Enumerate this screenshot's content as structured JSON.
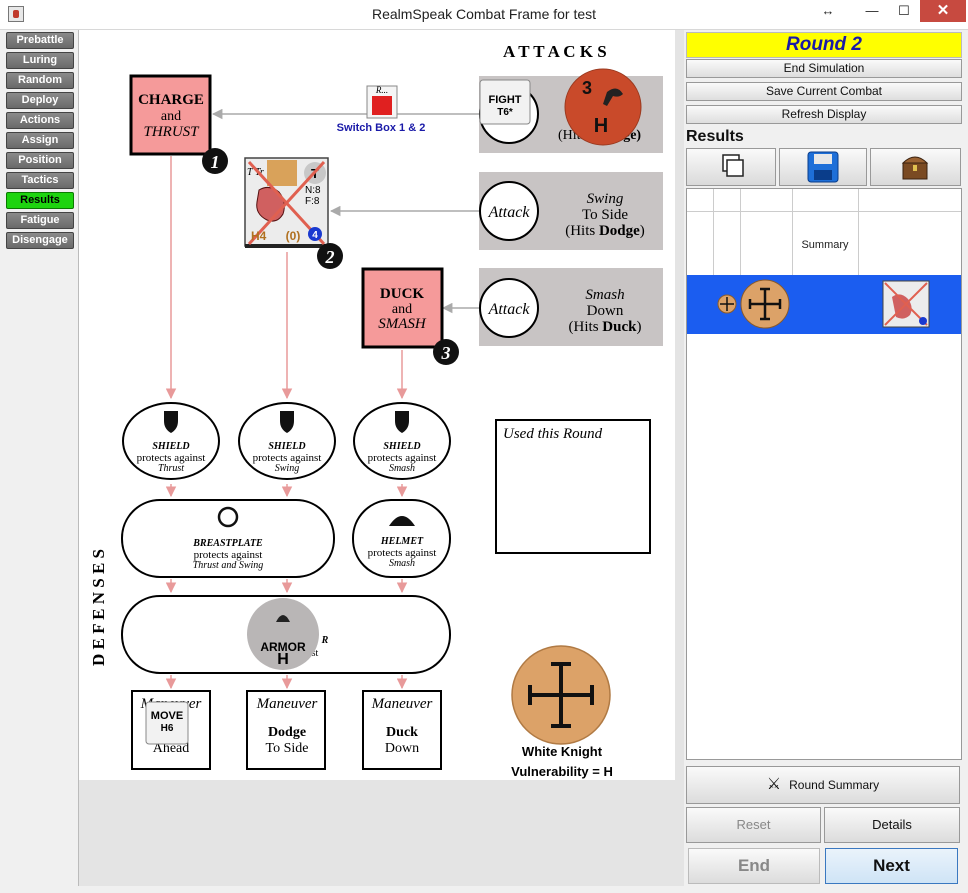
{
  "window": {
    "title": "RealmSpeak Combat Frame for test",
    "resize": "↔",
    "minimize": "—",
    "maximize": "☐",
    "close": "✕"
  },
  "nav": {
    "items": [
      {
        "label": "Prebattle"
      },
      {
        "label": "Luring"
      },
      {
        "label": "Random"
      },
      {
        "label": "Deploy"
      },
      {
        "label": "Actions"
      },
      {
        "label": "Assign"
      },
      {
        "label": "Position"
      },
      {
        "label": "Tactics"
      },
      {
        "label": "Results",
        "active": true
      },
      {
        "label": "Fatigue"
      },
      {
        "label": "Disengage"
      }
    ]
  },
  "board": {
    "attacks_title": "A T T A C K S",
    "defenses_title": "D E F E N S E S",
    "charge": {
      "line1": "CHARGE",
      "line2": "and",
      "line3": "THRUST",
      "number": "1"
    },
    "duck": {
      "line1": "DUCK",
      "line2": "and",
      "line3": "SMASH",
      "number": "3"
    },
    "switch_box": {
      "label": "R...",
      "text": "Switch Box 1 & 2"
    },
    "fight_chit": {
      "line1": "FIGHT",
      "line2": "T6*"
    },
    "monster_chit": {
      "number": "3",
      "letter": "H"
    },
    "attack_rows": [
      {
        "circle": "",
        "line1": "",
        "line2": "(Hits",
        "line3": "arge)"
      },
      {
        "circle": "Attack",
        "line1": "Swing",
        "line2": "To Side",
        "line3": "(Hits ",
        "bold": "Dodge",
        "end": ")"
      },
      {
        "circle": "Attack",
        "line1": "Smash",
        "line2": "Down",
        "line3": "(Hits ",
        "bold": "Duck",
        "end": ")"
      }
    ],
    "enemy_card": {
      "name": "T Tr",
      "type": "T",
      "stats1": "N:8",
      "stats2": "F:8",
      "bottom_left": "H4",
      "bottom_mid": "(0)",
      "badge": "4",
      "number": "2"
    },
    "used_round": "Used this Round",
    "shields": [
      {
        "title": "SHIELD",
        "line": "protects against",
        "target": "Thrust"
      },
      {
        "title": "SHIELD",
        "line": "protects against",
        "target": "Swing"
      },
      {
        "title": "SHIELD",
        "line": "protects against",
        "target": "Smash"
      }
    ],
    "breastplate": {
      "title": "BREASTPLATE",
      "line": "protects against",
      "target": "Thrust and Swing"
    },
    "helmet": {
      "title": "HELMET",
      "line": "protects against",
      "target": "Smash"
    },
    "armor_row": {
      "partial": "R",
      "partial2": "st"
    },
    "armor_chit": {
      "label": "ARMOR",
      "letter": "H"
    },
    "maneuvers": [
      {
        "title": "Maneuver",
        "line1": "",
        "line2": "Ahead"
      },
      {
        "title": "Maneuver",
        "line1": "Dodge",
        "line2": "To Side"
      },
      {
        "title": "Maneuver",
        "line1": "Duck",
        "line2": "Down"
      }
    ],
    "move_chit": {
      "line1": "MOVE",
      "line2": "H6"
    },
    "knight": {
      "name": "White Knight",
      "vulnerability": "Vulnerability = H"
    }
  },
  "right": {
    "round": "Round 2",
    "end_simulation": "End Simulation",
    "save_combat": "Save Current Combat",
    "refresh": "Refresh Display",
    "results_label": "Results",
    "summary_header": "Summary",
    "round_summary": "Round Summary",
    "reset": "Reset",
    "details": "Details",
    "end": "End",
    "next": "Next"
  },
  "colors": {
    "accent_yellow": "#ffff00",
    "active_green": "#1ed40f",
    "select_blue": "#1b5df0",
    "pink": "#f59a9a",
    "attack_gray": "#c8c4c4"
  }
}
